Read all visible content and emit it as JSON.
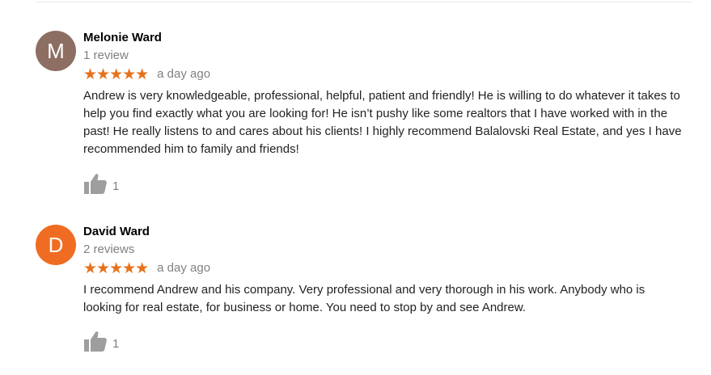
{
  "colors": {
    "star": "#e7711b",
    "muted_text": "#808080",
    "icon_gray": "#9e9e9e"
  },
  "reviews": [
    {
      "avatar_letter": "M",
      "avatar_color": "#8d6e63",
      "author": "Melonie Ward",
      "review_count": "1 review",
      "rating": 5,
      "stars": "★★★★★",
      "time_ago": "a day ago",
      "text": "Andrew is very knowledgeable, professional, helpful, patient and friendly! He is willing to do whatever it takes to help you find exactly what you are looking for! He isn’t pushy like some realtors that I have worked with in the past! He really listens to and cares about his clients! I highly recommend Balalovski Real Estate, and yes I have recommended him to family and friends!",
      "likes": "1",
      "like_icon": "thumbs-up-icon"
    },
    {
      "avatar_letter": "D",
      "avatar_color": "#ef6c22",
      "author": "David Ward",
      "review_count": "2 reviews",
      "rating": 5,
      "stars": "★★★★★",
      "time_ago": "a day ago",
      "text": "I recommend Andrew and his company. Very professional and very thorough in his work. Anybody who is looking for real estate, for business or home. You need to stop by and see Andrew.",
      "likes": "1",
      "like_icon": "thumbs-up-icon"
    }
  ]
}
